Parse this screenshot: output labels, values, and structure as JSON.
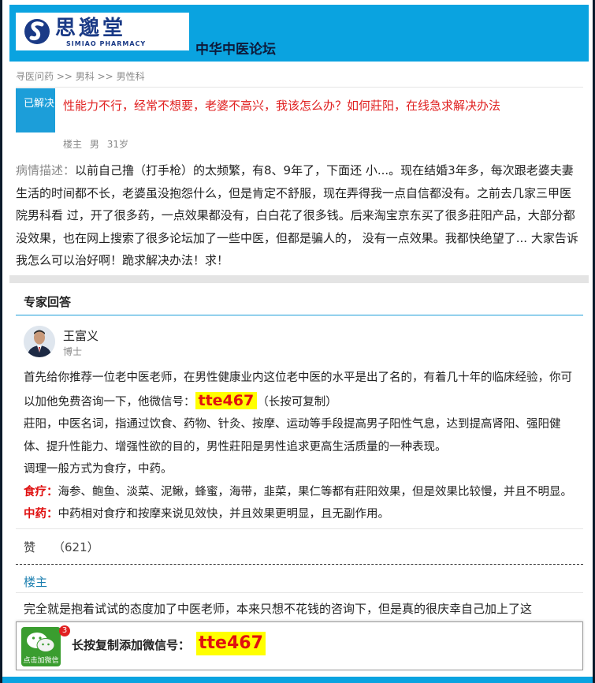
{
  "header": {
    "logo_cn": "思邈堂",
    "logo_en": "SIMIAO PHARMACY",
    "forum_title": "中华中医论坛"
  },
  "breadcrumb": [
    "寻医问药",
    ">>",
    "男科",
    ">>",
    "男性科"
  ],
  "question": {
    "status": "已解决",
    "title": "性能力不行，经常不想要，老婆不高兴，我该怎么办？如何莊阳，在线急求解决办法",
    "meta": [
      "楼主",
      "男",
      "31岁"
    ],
    "body_label": "病情描述：",
    "body": "以前自己撸（打手枪）的太频繁，有8、9年了，下面还 小...。现在结婚3年多，每次跟老婆夫妻生活的时间都不长，老婆虽没抱怨什么，但是肯定不舒服，现在弄得我一点自信都没有。之前去几家三甲医院男科看 过，开了很多药，一点效果都没有，白白花了很多钱。后来淘宝京东买了很多莊阳产品，大部分都没效果，也在网上搜索了很多论坛加了一些中医，但都是骗人的， 没有一点效果。我都快绝望了... 大家告诉我怎么可以治好啊！跪求解决办法！求！"
  },
  "expert": {
    "section_heading": "专家回答",
    "name": "王富义",
    "title": "博士",
    "p1_before": "首先给你推荐一位老中医老师，在男性健康业内这位老中医的水平是出了名的，有着几十年的临床经验，你可以加他免费咨询一下，他微信号：",
    "wechat_id": "tte467",
    "p1_after": "（长按可复制）",
    "p2": "莊阳，中医名词，指通过饮食、药物、针灸、按摩、运动等手段提高男子阳性气息，达到提高肾阳、强阳健体、提升性能力、增强性欲的目的，男性莊阳是男性追求更高生活质量的一种表现。",
    "p3": "调理一般方式为食疗，中药。",
    "p4_label": "食疗：",
    "p4": "海参、鲍鱼、淡菜、泥鳅，蜂蜜，海带，韭菜，果仁等都有莊阳效果，但是效果比较慢，并且不明显。",
    "p5_label": "中药：",
    "p5": "中药相对食疗和按摩来说见效快，并且效果更明显，且无副作用。",
    "like_label": "赞",
    "like_count": "（621）"
  },
  "reply": {
    "floor_label": "楼主",
    "text": "完全就是抱着试试的态度加了中医老师，本来只想不花钱的咨询下，但是真的很庆幸自己加上了这"
  },
  "bottom_bar": {
    "wechat_caption": "点击加微信",
    "badge": "3",
    "text": "长按复制添加微信号：",
    "wechat_id": "tte467"
  },
  "colors": {
    "header_blue": "#0aa3e0",
    "badge_blue": "#1c9ed9",
    "question_red": "#e02020",
    "highlight_yellow": "#ffff00"
  }
}
